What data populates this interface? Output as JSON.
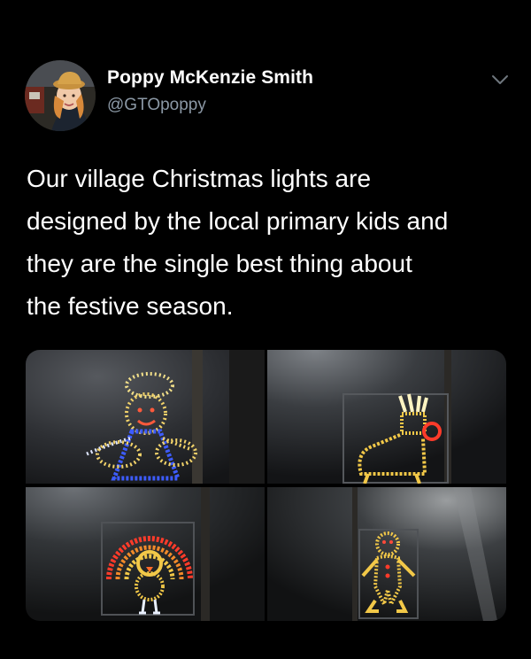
{
  "tweet": {
    "author": {
      "display_name": "Poppy McKenzie Smith",
      "handle": "@GTOpoppy",
      "avatar_icon": "user-avatar"
    },
    "menu_icon": "chevron-down-icon",
    "text": "Our village Christmas lights are\ndesigned by the local primary kids and\nthey are the single best thing about\nthe festive season.",
    "media": [
      {
        "subject": "angel-light"
      },
      {
        "subject": "reindeer-light"
      },
      {
        "subject": "turkey-light"
      },
      {
        "subject": "gingerbread-man-light"
      }
    ]
  },
  "colors": {
    "background": "#000000",
    "text_primary": "#ffffff",
    "text_secondary": "#8b98a5"
  }
}
